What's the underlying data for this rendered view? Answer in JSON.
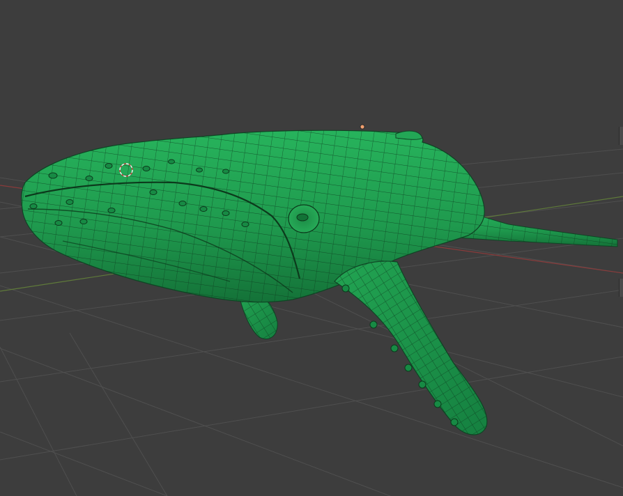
{
  "viewport": {
    "background_color": "#3d3d3d",
    "grid_color": "#4e4e4e",
    "x_axis_color": "#8a3b3b",
    "y_axis_color": "#5f7a3a",
    "mesh_color": "#1f9a4e",
    "mesh_shade_color": "#157a3a",
    "wire_color": "#0d3a1e",
    "origin_color": "#f0a070",
    "cursor_icon": "3d-cursor-icon"
  }
}
